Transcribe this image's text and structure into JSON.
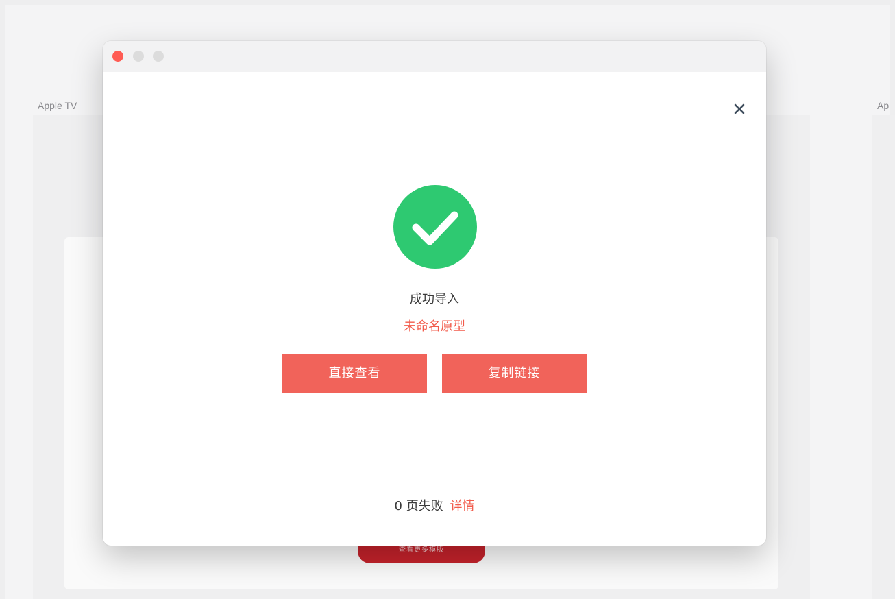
{
  "background": {
    "left_card_title": "Apple TV",
    "right_card_title": "Ap",
    "more_templates_button": "查看更多模版"
  },
  "dialog": {
    "window_controls": [
      "close",
      "minimize",
      "maximize"
    ],
    "close_icon": "close-icon",
    "status_icon": "check-circle-icon",
    "status_title": "成功导入",
    "prototype_name": "未命名原型",
    "buttons": {
      "view_directly": "直接查看",
      "copy_link": "复制链接"
    },
    "footer": {
      "failed_count": "0",
      "failed_text": "页失败",
      "details_link": "详情"
    }
  },
  "colors": {
    "accent": "#f1635a",
    "success": "#2ec971",
    "link": "#f25b4b",
    "background_button": "#c4222b"
  }
}
